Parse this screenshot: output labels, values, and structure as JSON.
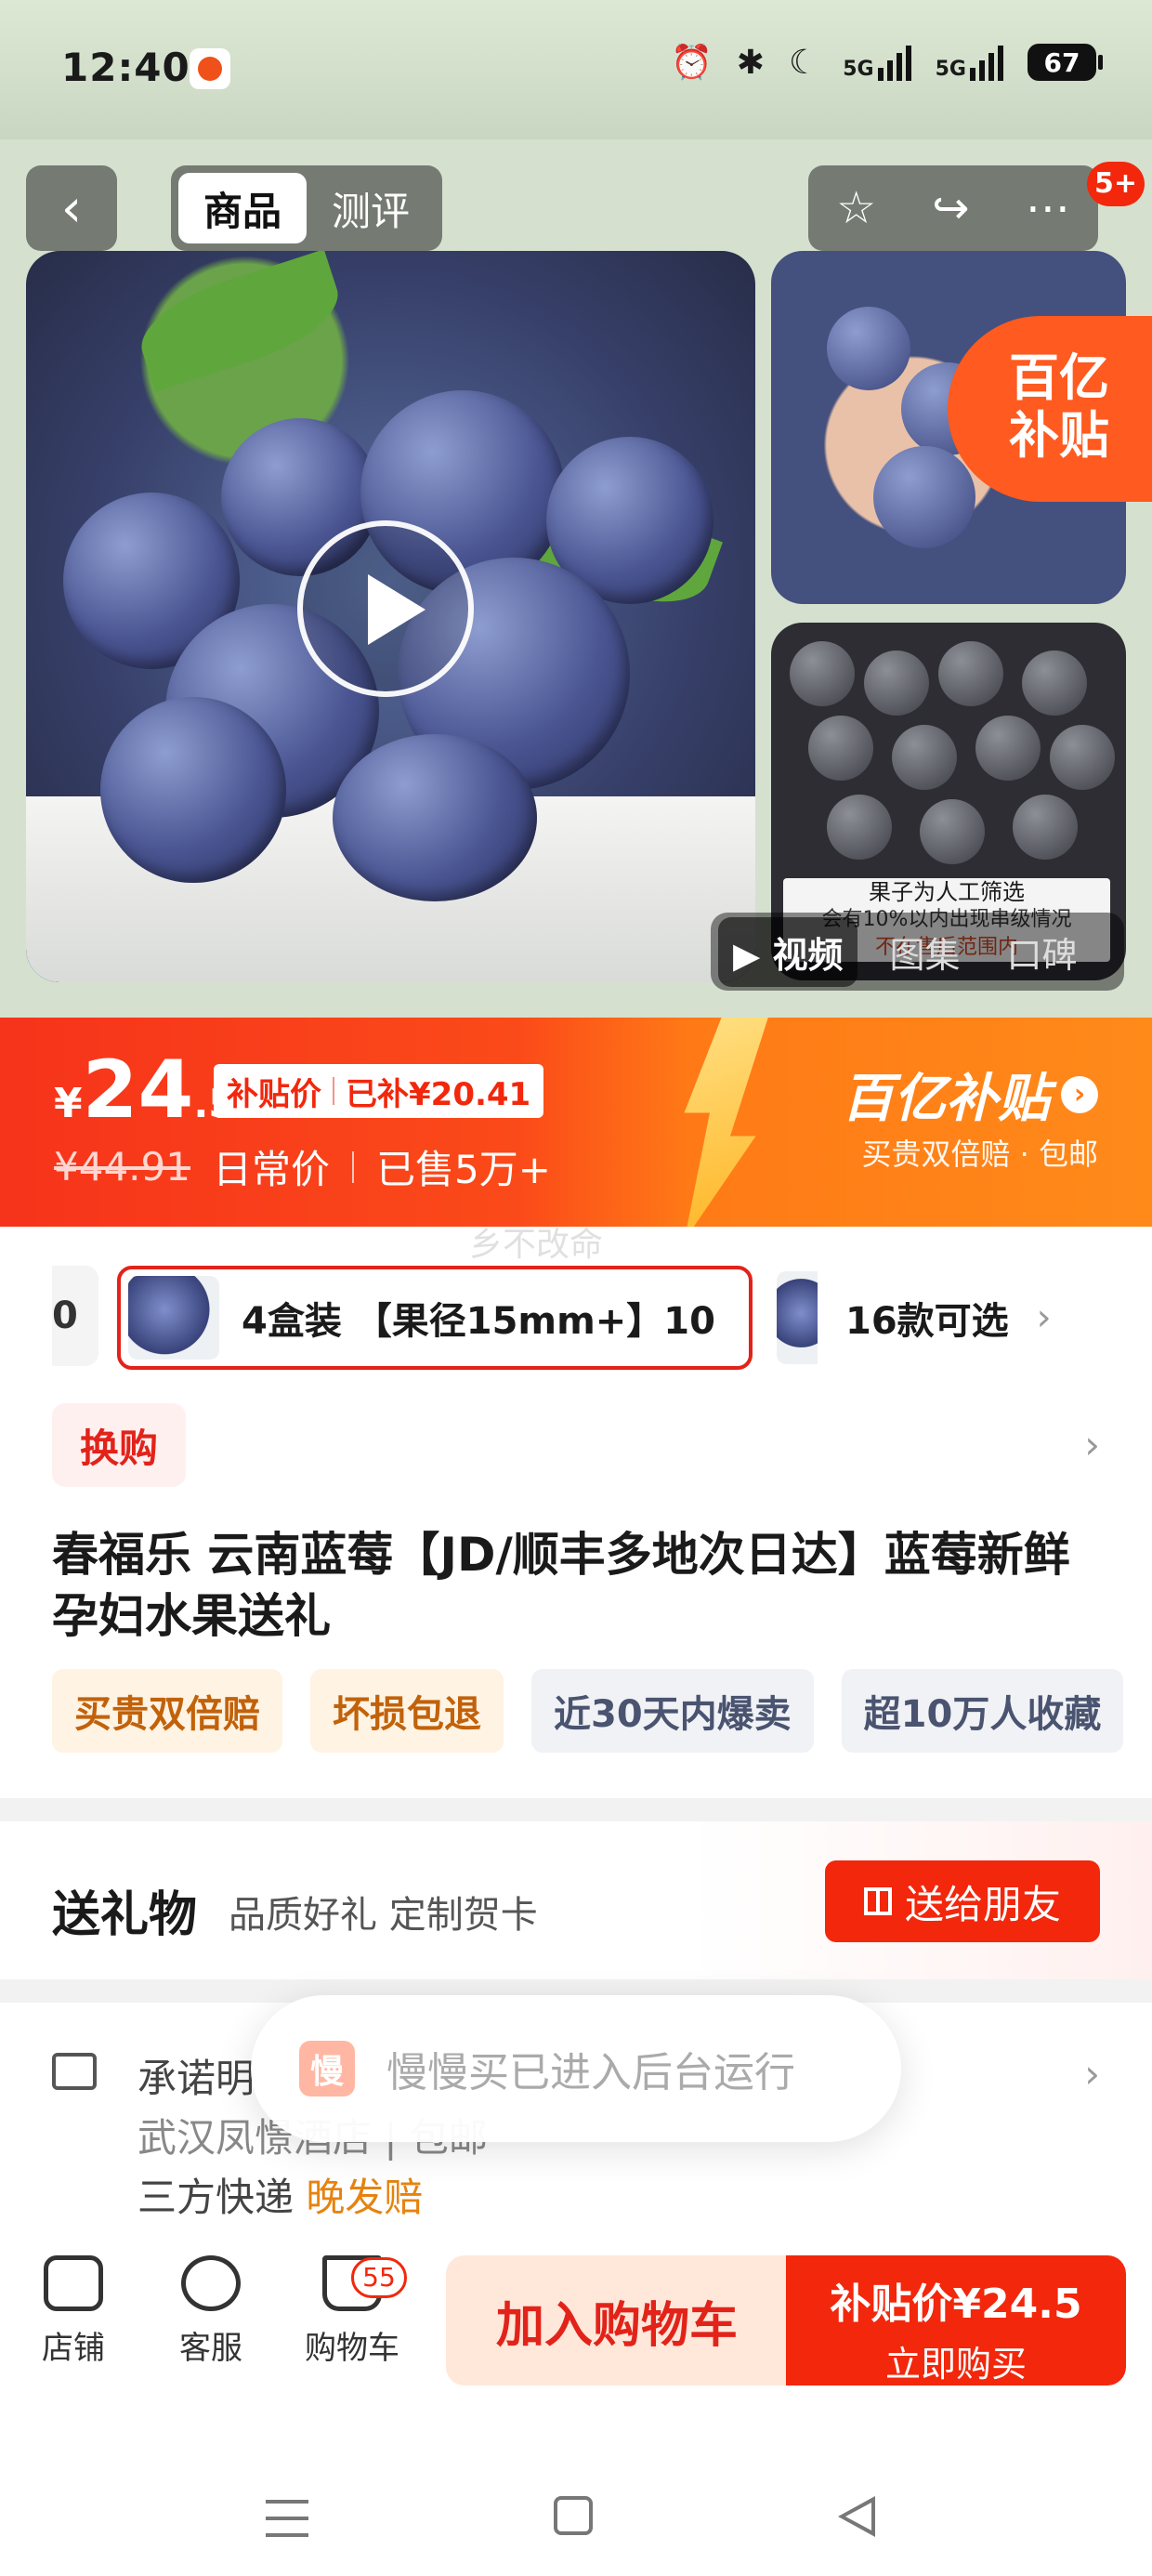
{
  "status_bar": {
    "time": "12:40",
    "network_a": "5G",
    "network_b": "5G",
    "battery": "67"
  },
  "top_nav": {
    "tabs": [
      "商品",
      "测评"
    ],
    "active_tab": "商品",
    "notification_badge": "5+"
  },
  "gallery": {
    "subsidy_badge": [
      "百亿",
      "补贴"
    ],
    "side_note_line1": "果子为人工筛选",
    "side_note_line2": "会有10%以内出现串级情况",
    "side_note_line3": "不在售后范围内",
    "media_tabs": [
      "视频",
      "图集",
      "口碑"
    ],
    "active_media_tab": "视频"
  },
  "price": {
    "currency": "¥",
    "integer": "24",
    "decimal": ".5",
    "tag_label": "补贴价",
    "tag_saved": "已补¥20.41",
    "original": "¥44.91",
    "original_label": "日常价",
    "sold": "已售5万+",
    "brand": "百亿补贴",
    "brand_sub": "买贵双倍赔 · 包邮"
  },
  "watermark": "乡不改命",
  "variants": {
    "prev_stub": "0",
    "selected": "4盒装 【果径15mm+】10",
    "more_count": "16款可选"
  },
  "swap_tag": "换购",
  "product_title": "春福乐 云南蓝莓【JD/顺丰多地次日达】蓝莓新鲜孕妇水果送礼",
  "tags": [
    {
      "label": "买贵双倍赔",
      "style": "warm"
    },
    {
      "label": "坏损包退",
      "style": "warm"
    },
    {
      "label": "近30天内爆卖",
      "style": "cool"
    },
    {
      "label": "超10万人收藏",
      "style": "cool"
    }
  ],
  "gift": {
    "title": "送礼物",
    "subtitle": "品质好礼 定制贺卡",
    "button": "送给朋友"
  },
  "shipping": {
    "line1": "承诺明",
    "line2": "武汉凤憬酒店 | 包邮",
    "line3_prefix": "三方快递",
    "line3_highlight": "晚发赔"
  },
  "toast": {
    "icon_char": "慢",
    "text": "慢慢买已进入后台运行"
  },
  "bottom_bar": {
    "store": "店铺",
    "service": "客服",
    "cart": "购物车",
    "cart_count": "55",
    "add_to_cart": "加入购物车",
    "buy_price": "补贴价¥24.5",
    "buy_now": "立即购买"
  },
  "colors": {
    "accent_red": "#f2270c",
    "subsidy_orange": "#ff7a16",
    "warm_tag_text": "#c1620b"
  }
}
